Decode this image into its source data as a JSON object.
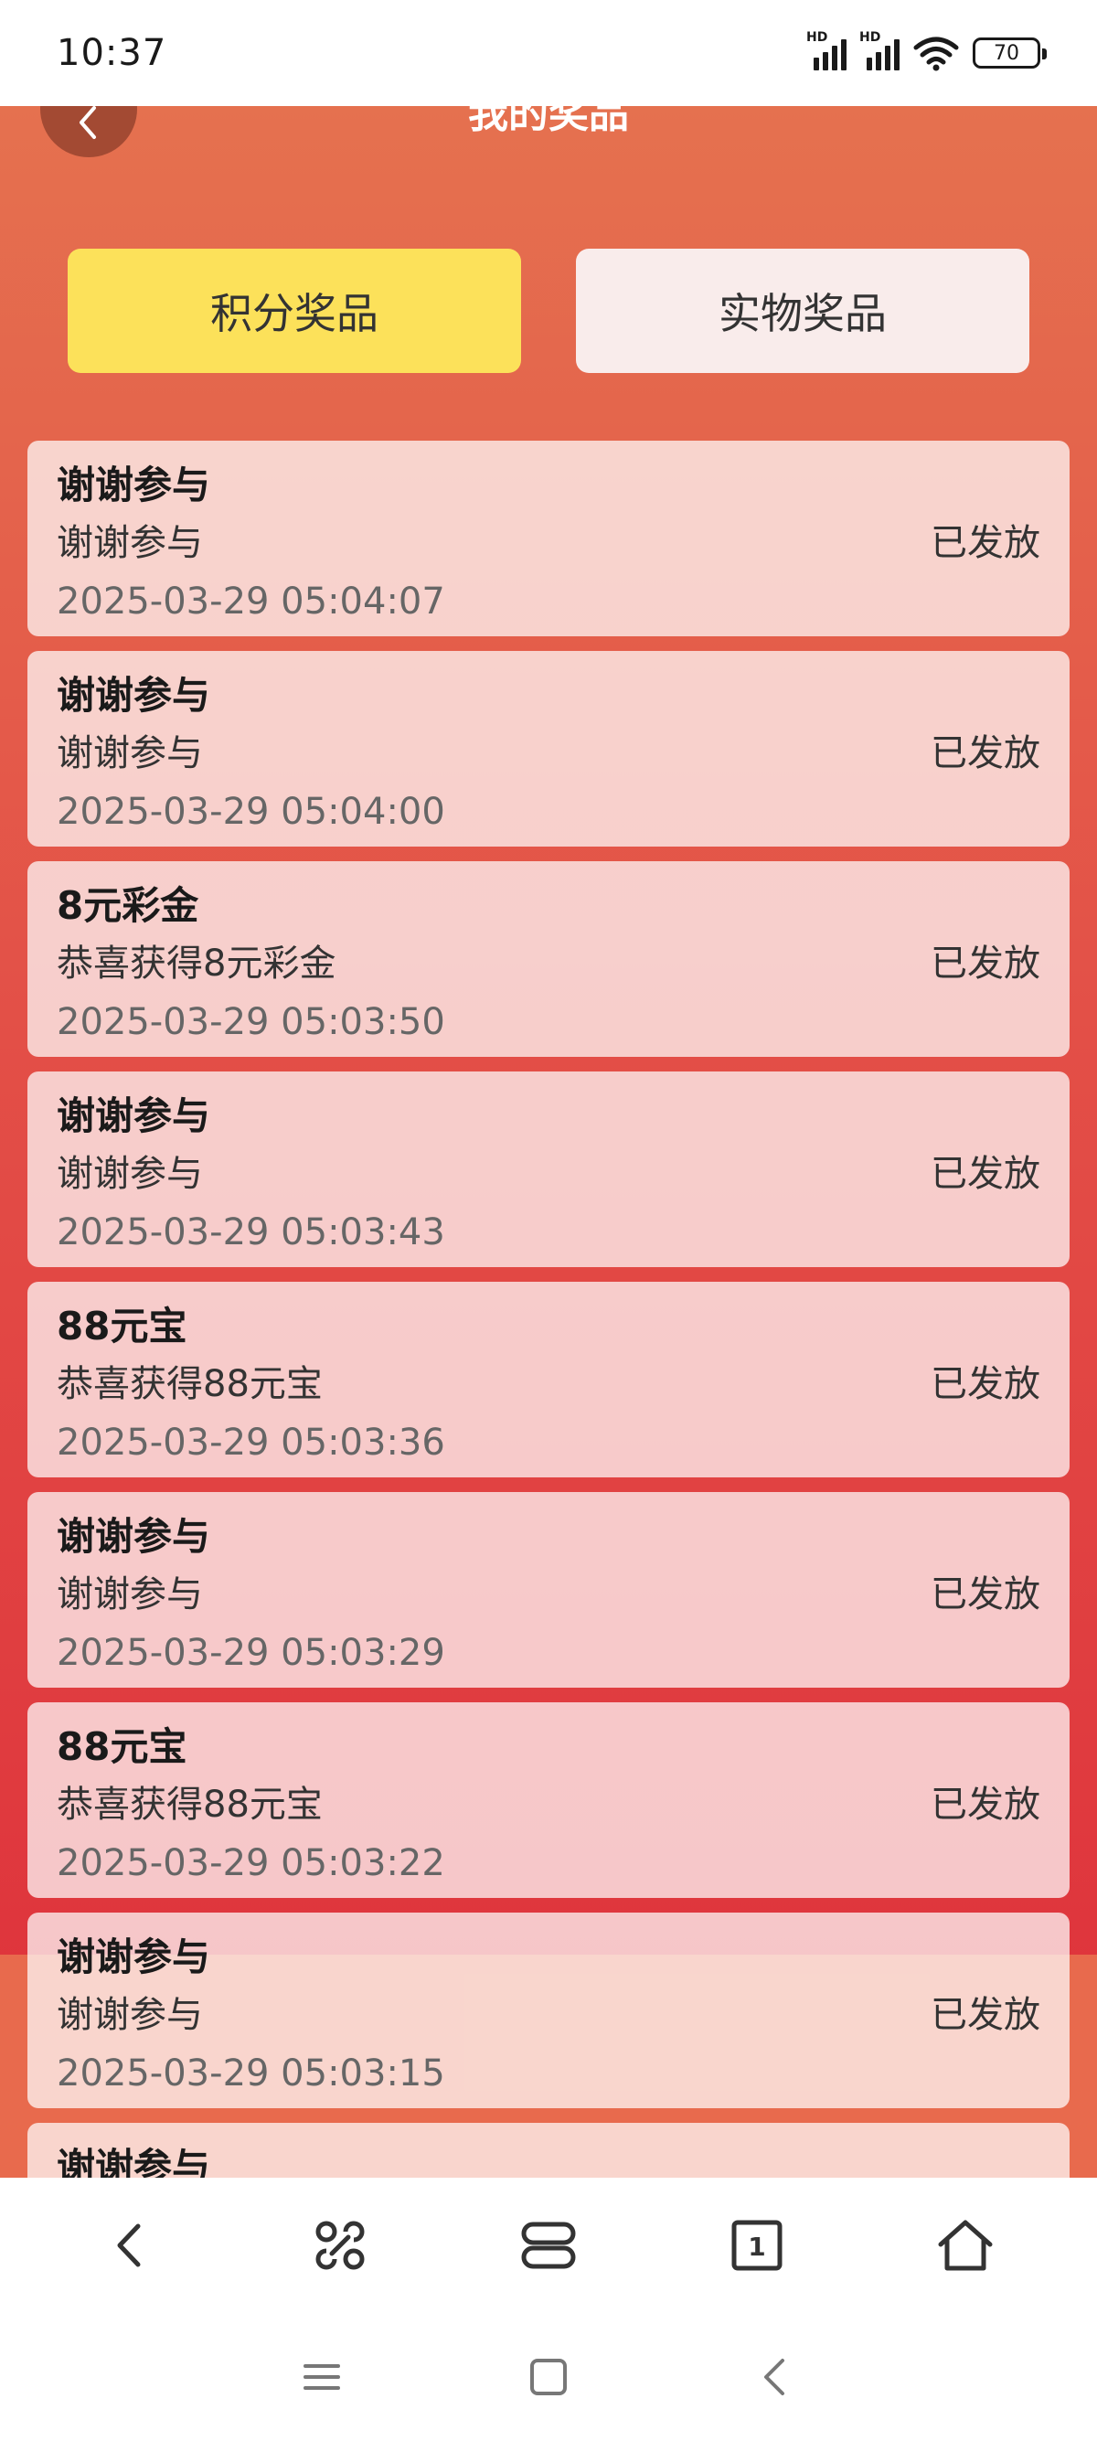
{
  "status_bar": {
    "time": "10:37",
    "signal1_label": "HD",
    "signal2_label": "HD",
    "battery": "70"
  },
  "header": {
    "title": "我的奖品",
    "back_icon": "back-arrow-icon"
  },
  "tabs": [
    {
      "label": "积分奖品",
      "active": true
    },
    {
      "label": "实物奖品",
      "active": false
    }
  ],
  "prizes": [
    {
      "title": "谢谢参与",
      "desc": "谢谢参与",
      "time": "2025-03-29 05:04:07",
      "status": "已发放"
    },
    {
      "title": "谢谢参与",
      "desc": "谢谢参与",
      "time": "2025-03-29 05:04:00",
      "status": "已发放"
    },
    {
      "title": "8元彩金",
      "desc": "恭喜获得8元彩金",
      "time": "2025-03-29 05:03:50",
      "status": "已发放"
    },
    {
      "title": "谢谢参与",
      "desc": "谢谢参与",
      "time": "2025-03-29 05:03:43",
      "status": "已发放"
    },
    {
      "title": "88元宝",
      "desc": "恭喜获得88元宝",
      "time": "2025-03-29 05:03:36",
      "status": "已发放"
    },
    {
      "title": "谢谢参与",
      "desc": "谢谢参与",
      "time": "2025-03-29 05:03:29",
      "status": "已发放"
    },
    {
      "title": "88元宝",
      "desc": "恭喜获得88元宝",
      "time": "2025-03-29 05:03:22",
      "status": "已发放"
    },
    {
      "title": "谢谢参与",
      "desc": "谢谢参与",
      "time": "2025-03-29 05:03:15",
      "status": "已发放"
    },
    {
      "title": "谢谢参与",
      "desc": "",
      "time": "",
      "status": ""
    }
  ],
  "browser_toolbar": [
    "back-icon",
    "command-icon",
    "tabs-overview-icon",
    "tab-count-icon",
    "home-icon"
  ],
  "browser_tab_count": "1",
  "system_nav": [
    "menu-icon",
    "home-square-icon",
    "back-chevron-icon"
  ]
}
